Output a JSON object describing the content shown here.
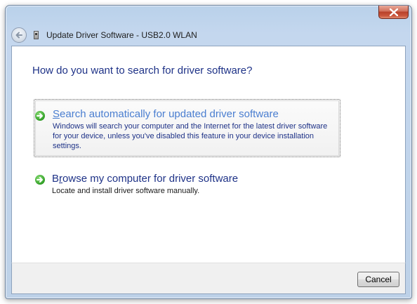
{
  "window": {
    "title": "Update Driver Software - USB2.0 WLAN"
  },
  "titlebar": {
    "back_icon": "back-arrow-icon",
    "close_icon": "close-x-icon"
  },
  "main": {
    "heading": "How do you want to search for driver software?",
    "options": [
      {
        "title_accel": "S",
        "title_rest": "earch automatically for updated driver software",
        "description": "Windows will search your computer and the Internet for the latest driver software for your device, unless you've disabled this feature in your device installation settings.",
        "icon": "green-arrow-icon",
        "selected": true
      },
      {
        "title_pre": "B",
        "title_accel": "r",
        "title_rest": "owse my computer for driver software",
        "description": "Locate and install driver software manually.",
        "icon": "green-arrow-icon",
        "selected": false
      }
    ]
  },
  "footer": {
    "cancel_label": "Cancel"
  },
  "colors": {
    "heading": "#1e3287",
    "selected_link": "#4a7ed0",
    "accent_green": "#2f9e25",
    "close_red": "#c9553c"
  }
}
